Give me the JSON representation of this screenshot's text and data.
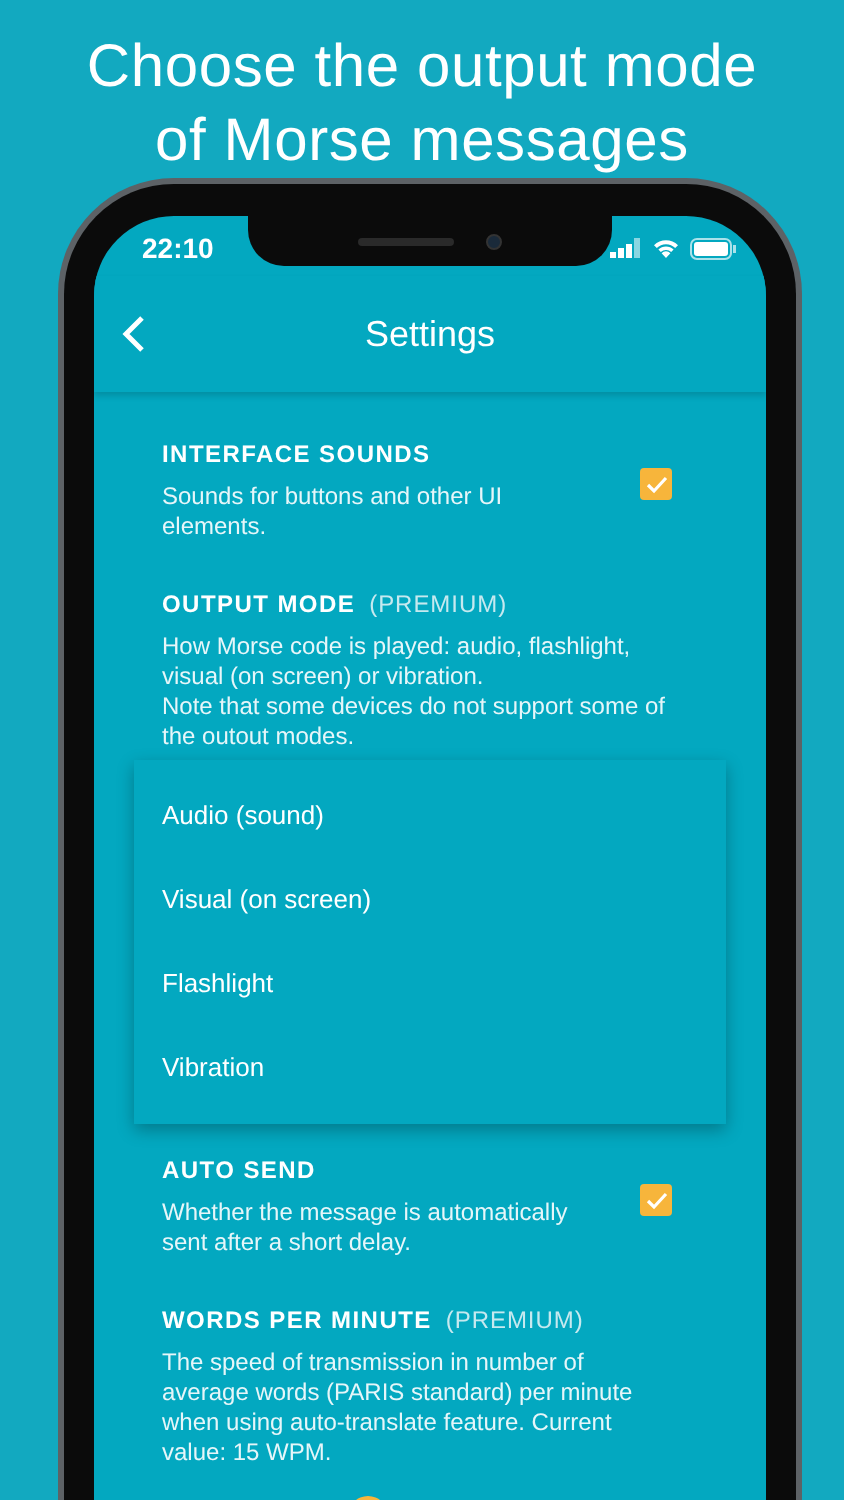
{
  "headline": [
    "Choose the output mode",
    "of Morse messages"
  ],
  "status_bar": {
    "time": "22:10"
  },
  "header": {
    "title": "Settings"
  },
  "settings": [
    {
      "kind": "checkbox",
      "title": "INTERFACE SOUNDS",
      "description": "Sounds for buttons and other UI elements.",
      "checked": true
    },
    {
      "kind": "select",
      "title": "OUTPUT MODE",
      "badge": "(PREMIUM)",
      "description": [
        "How Morse code is played: audio, flashlight, visual (on screen) or vibration.",
        "Note that some devices do not support some of the outout modes."
      ],
      "menu": [
        "Audio (sound)",
        "Visual (on screen)",
        "Flashlight",
        "Vibration"
      ]
    },
    {
      "kind": "checkbox",
      "title": "AUTO SEND",
      "description": "Whether the message is automatically sent after a short delay.",
      "checked": true
    },
    {
      "kind": "slider",
      "title": "WORDS PER MINUTE",
      "badge": "(PREMIUM)",
      "description": [
        "The speed of transmission in number of average words (PARIS standard) per minute when using auto-translate feature. Current value: 15 WPM."
      ],
      "level": 0.39
    }
  ]
}
